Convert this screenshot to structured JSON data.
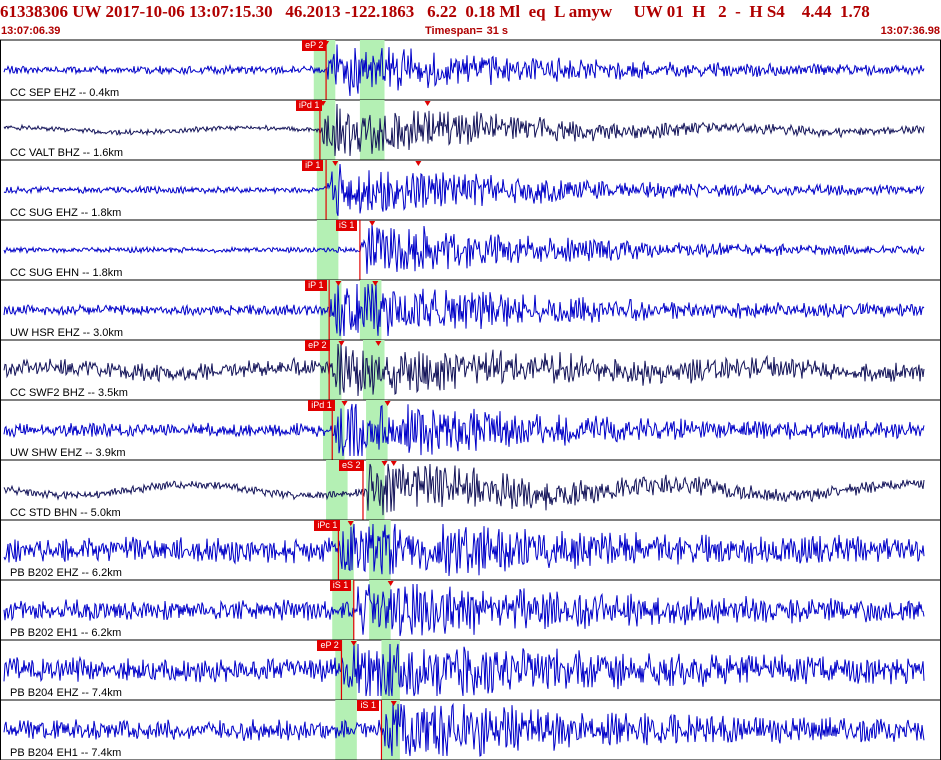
{
  "header": {
    "event_id": "61338306",
    "network": "UW",
    "datetime": "2017-10-06 13:07:15.30",
    "lat": "46.2013",
    "lon": "-122.1863",
    "depth": "6.22",
    "magnitude": "0.18",
    "mag_type": "Ml",
    "event_type": "eq",
    "flag": "L",
    "analyst": "amyw",
    "source": "UW",
    "version": "01",
    "h": "H",
    "gap": "2",
    "dash": "-",
    "hs": "H S4",
    "value1": "4.44",
    "value2": "1.78"
  },
  "time_axis": {
    "start": "13:07:06.39",
    "end": "13:07:36.98",
    "timespan_label": "Timespan=",
    "timespan_value": "31 s"
  },
  "colors": {
    "trace_blue": "#0000c8",
    "trace_dark": "#14145a",
    "pick": "#e00000",
    "window_green": "#b4f0b4",
    "header_red": "#b00000"
  },
  "traces": [
    {
      "label": "CC SEP EHZ -- 0.4km",
      "color": "dark_blue",
      "noise_amplitude": 0.12,
      "signal_amplitude": 0.8,
      "long_period": 0.0,
      "picks": [
        {
          "label": "eP 2",
          "time_s": 10.6
        }
      ],
      "arrivals": [
        {
          "time_s": 10.6
        }
      ],
      "windows": [
        {
          "start_s": 10.2,
          "end_s": 10.9
        },
        {
          "start_s": 11.7,
          "end_s": 12.5
        }
      ]
    },
    {
      "label": "CC VALT BHZ -- 1.6km",
      "color": "dark",
      "noise_amplitude": 0.08,
      "signal_amplitude": 0.9,
      "long_period": 0.15,
      "picks": [
        {
          "label": "iPd 1",
          "time_s": 10.4
        }
      ],
      "arrivals": [
        {
          "time_s": 10.5
        },
        {
          "time_s": 13.9
        }
      ],
      "windows": [
        {
          "start_s": 10.2,
          "end_s": 10.9
        },
        {
          "start_s": 11.7,
          "end_s": 12.5
        }
      ]
    },
    {
      "label": "CC SUG EHZ -- 1.8km",
      "color": "blue",
      "noise_amplitude": 0.1,
      "signal_amplitude": 0.9,
      "long_period": 0.0,
      "picks": [
        {
          "label": "iP 1",
          "time_s": 10.6
        }
      ],
      "arrivals": [
        {
          "time_s": 10.9
        },
        {
          "time_s": 13.6
        }
      ],
      "windows": [
        {
          "start_s": 10.3,
          "end_s": 11.0
        }
      ]
    },
    {
      "label": "CC SUG EHN -- 1.8km",
      "color": "blue",
      "noise_amplitude": 0.08,
      "signal_amplitude": 0.85,
      "long_period": 0.0,
      "picks": [
        {
          "label": "iS 1",
          "time_s": 11.7
        }
      ],
      "arrivals": [
        {
          "time_s": 12.1
        }
      ],
      "windows": [
        {
          "start_s": 10.3,
          "end_s": 11.0
        }
      ]
    },
    {
      "label": "UW HSR EHZ -- 3.0km",
      "color": "blue",
      "noise_amplitude": 0.15,
      "signal_amplitude": 0.95,
      "long_period": 0.0,
      "picks": [
        {
          "label": "iP 1",
          "time_s": 10.7
        }
      ],
      "arrivals": [
        {
          "time_s": 11.0
        },
        {
          "time_s": 12.2
        }
      ],
      "windows": [
        {
          "start_s": 10.4,
          "end_s": 11.1
        },
        {
          "start_s": 11.7,
          "end_s": 12.4
        }
      ]
    },
    {
      "label": "CC SWF2 BHZ -- 3.5km",
      "color": "dark",
      "noise_amplitude": 0.25,
      "signal_amplitude": 0.7,
      "long_period": 0.2,
      "picks": [
        {
          "label": "eP 2",
          "time_s": 10.7
        }
      ],
      "arrivals": [
        {
          "time_s": 11.1
        },
        {
          "time_s": 12.3
        }
      ],
      "windows": [
        {
          "start_s": 10.4,
          "end_s": 11.1
        },
        {
          "start_s": 11.8,
          "end_s": 12.5
        }
      ]
    },
    {
      "label": "UW SHW EHZ -- 3.9km",
      "color": "blue",
      "noise_amplitude": 0.2,
      "signal_amplitude": 0.9,
      "long_period": 0.0,
      "picks": [
        {
          "label": "iPd 1",
          "time_s": 10.8
        }
      ],
      "arrivals": [
        {
          "time_s": 11.2
        },
        {
          "time_s": 12.6
        }
      ],
      "windows": [
        {
          "start_s": 10.5,
          "end_s": 11.2
        },
        {
          "start_s": 11.9,
          "end_s": 12.6
        }
      ]
    },
    {
      "label": "CC STD BHN -- 5.0km",
      "color": "dark",
      "noise_amplitude": 0.12,
      "signal_amplitude": 0.9,
      "long_period": 0.35,
      "picks": [
        {
          "label": "eS 2",
          "time_s": 11.8
        }
      ],
      "arrivals": [
        {
          "time_s": 12.5
        },
        {
          "time_s": 12.8
        }
      ],
      "windows": [
        {
          "start_s": 10.6,
          "end_s": 11.3
        },
        {
          "start_s": 11.9,
          "end_s": 12.5
        }
      ]
    },
    {
      "label": "PB B202 EHZ -- 6.2km",
      "color": "blue",
      "noise_amplitude": 0.35,
      "signal_amplitude": 0.8,
      "long_period": 0.1,
      "picks": [
        {
          "label": "iPc 1",
          "time_s": 11.0
        }
      ],
      "arrivals": [
        {
          "time_s": 11.4
        }
      ],
      "windows": [
        {
          "start_s": 10.8,
          "end_s": 11.5
        },
        {
          "start_s": 12.0,
          "end_s": 12.7
        }
      ]
    },
    {
      "label": "PB B202 EH1 -- 6.2km",
      "color": "blue",
      "noise_amplitude": 0.3,
      "signal_amplitude": 0.8,
      "long_period": 0.0,
      "picks": [
        {
          "label": "iS 1",
          "time_s": 11.5
        }
      ],
      "arrivals": [
        {
          "time_s": 12.7
        }
      ],
      "windows": [
        {
          "start_s": 10.8,
          "end_s": 11.5
        },
        {
          "start_s": 12.0,
          "end_s": 12.7
        }
      ]
    },
    {
      "label": "PB B204 EHZ -- 7.4km",
      "color": "blue",
      "noise_amplitude": 0.35,
      "signal_amplitude": 0.85,
      "long_period": 0.05,
      "picks": [
        {
          "label": "eP 2",
          "time_s": 11.1
        }
      ],
      "arrivals": [
        {
          "time_s": 11.5
        }
      ],
      "windows": [
        {
          "start_s": 10.9,
          "end_s": 11.6
        },
        {
          "start_s": 12.4,
          "end_s": 13.0
        }
      ]
    },
    {
      "label": "PB B204 EH1 -- 7.4km",
      "color": "blue",
      "noise_amplitude": 0.3,
      "signal_amplitude": 0.85,
      "long_period": 0.0,
      "picks": [
        {
          "label": "iS 1",
          "time_s": 12.4
        }
      ],
      "arrivals": [
        {
          "time_s": 12.8
        }
      ],
      "windows": [
        {
          "start_s": 10.9,
          "end_s": 11.6
        },
        {
          "start_s": 12.4,
          "end_s": 13.0
        }
      ]
    }
  ]
}
